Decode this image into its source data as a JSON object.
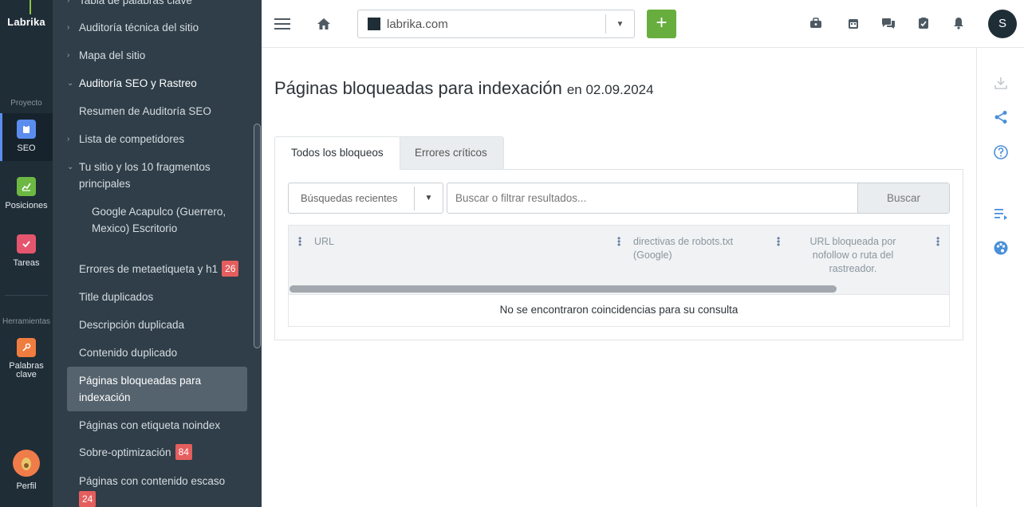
{
  "app": {
    "logo": "Labrika"
  },
  "rail": {
    "section_project": "Proyecto",
    "section_tools": "Herramientas",
    "items": [
      {
        "label": "SEO",
        "icon": "clipboard-icon",
        "color": "#5b8def"
      },
      {
        "label": "Posiciones",
        "icon": "chart-icon",
        "color": "#6cb842"
      },
      {
        "label": "Tareas",
        "icon": "check-icon",
        "color": "#e5566e"
      },
      {
        "label": "Palabras clave",
        "icon": "key-icon",
        "color": "#ef7d3f"
      },
      {
        "label": "Perfil",
        "icon": "avocado-icon",
        "color": "#f07c4a"
      }
    ]
  },
  "subnav": {
    "items": [
      {
        "label": "Tabla de palabras clave"
      },
      {
        "label": "Auditoría técnica del sitio"
      },
      {
        "label": "Mapa del sitio"
      },
      {
        "label": "Auditoría SEO y Rastreo"
      },
      {
        "label": "Resumen de Auditoría SEO"
      },
      {
        "label": "Lista de competidores"
      },
      {
        "label": "Tu sitio y los 10 fragmentos principales"
      },
      {
        "label": "Google Acapulco (Guerrero, Mexico) Escritorio"
      },
      {
        "label": "Errores de metaetiqueta y h1",
        "badge": "26"
      },
      {
        "label": "Title duplicados"
      },
      {
        "label": "Descripción duplicada"
      },
      {
        "label": "Contenido duplicado"
      },
      {
        "label": "Páginas bloqueadas para indexación"
      },
      {
        "label": "Páginas con etiqueta noindex"
      },
      {
        "label": "Sobre-optimización",
        "badge": "84"
      },
      {
        "label": "Páginas con contenido escaso",
        "badge": "24"
      }
    ]
  },
  "topbar": {
    "site": "labrika.com",
    "add_label": "+",
    "user_initial": "S"
  },
  "main": {
    "title": "Páginas bloqueadas para indexación",
    "date": "en 02.09.2024",
    "tabs": [
      {
        "label": "Todos los bloqueos"
      },
      {
        "label": "Errores críticos"
      }
    ],
    "recent_label": "Búsquedas recientes",
    "search_placeholder": "Buscar o filtrar resultados...",
    "search_button": "Buscar",
    "columns": [
      {
        "label": "URL"
      },
      {
        "label": "directivas de robots.txt (Google)"
      },
      {
        "label": "URL bloqueada por nofollow o ruta del rastreador."
      }
    ],
    "empty_message": "No se encontraron coincidencias para su consulta"
  },
  "colors": {
    "sidebar_dark": "#1f2d37",
    "sidebar": "#2f3e49",
    "accent_green": "#67ae3e",
    "badge_red": "#e55e5e",
    "right_icon_blue": "#4a90d9"
  }
}
